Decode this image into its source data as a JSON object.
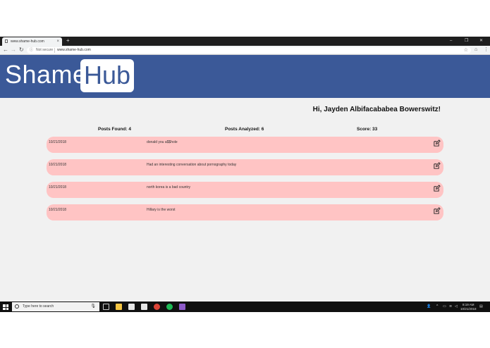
{
  "browser": {
    "tab_title": "www.shame-hub.com",
    "tab_close": "×",
    "new_tab": "+",
    "url_security": "Not secure",
    "url": "www.shame-hub.com",
    "minimize": "–",
    "maximize": "❐",
    "close": "✕"
  },
  "header": {
    "logo_left": "Shame",
    "logo_right": "Hub",
    "background": "#3b5998"
  },
  "main": {
    "greeting": "Hi, Jayden Albifacababea Bowerswitz!",
    "stats": {
      "posts_found": "Posts Found: 4",
      "posts_analyzed": "Posts Analyzed: 6",
      "score": "Score: 33"
    },
    "posts": [
      {
        "date": "10/21/2018",
        "text": "donald you a$$hole"
      },
      {
        "date": "10/21/2018",
        "text": "Had an interesting conversation about pornography today"
      },
      {
        "date": "10/21/2018",
        "text": "north korea is a bad country"
      },
      {
        "date": "10/21/2018",
        "text": "Hillary is the worst"
      }
    ],
    "row_color": "#ffc4c4",
    "edit_icon": "edit-icon"
  },
  "taskbar": {
    "search_placeholder": "Type here to search",
    "time": "8:19 AM",
    "date": "10/21/2018"
  }
}
